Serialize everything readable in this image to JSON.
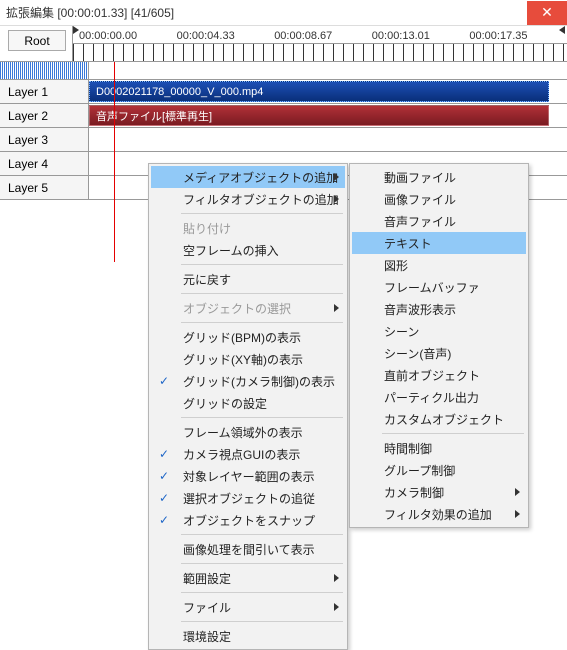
{
  "window": {
    "title": "拡張編集 [00:00:01.33] [41/605]"
  },
  "toolbar": {
    "root_label": "Root"
  },
  "ruler": {
    "labels": [
      "00:00:00.00",
      "00:00:04.33",
      "00:00:08.67",
      "00:00:13.01",
      "00:00:17.35"
    ]
  },
  "layers": [
    {
      "label": "Layer 1",
      "clip": "D0002021178_00000_V_000.mp4",
      "clip_type": "video"
    },
    {
      "label": "Layer 2",
      "clip": "音声ファイル[標準再生]",
      "clip_type": "audio"
    },
    {
      "label": "Layer 3"
    },
    {
      "label": "Layer 4"
    },
    {
      "label": "Layer 5"
    }
  ],
  "context_menu": [
    {
      "label": "メディアオブジェクトの追加",
      "submenu": true,
      "highlight": true
    },
    {
      "label": "フィルタオブジェクトの追加",
      "submenu": true
    },
    {
      "sep": true
    },
    {
      "label": "貼り付け",
      "disabled": true
    },
    {
      "label": "空フレームの挿入"
    },
    {
      "sep": true
    },
    {
      "label": "元に戻す"
    },
    {
      "sep": true
    },
    {
      "label": "オブジェクトの選択",
      "submenu": true,
      "disabled": true
    },
    {
      "sep": true
    },
    {
      "label": "グリッド(BPM)の表示"
    },
    {
      "label": "グリッド(XY軸)の表示"
    },
    {
      "label": "グリッド(カメラ制御)の表示",
      "checked": true
    },
    {
      "label": "グリッドの設定"
    },
    {
      "sep": true
    },
    {
      "label": "フレーム領域外の表示"
    },
    {
      "label": "カメラ視点GUIの表示",
      "checked": true
    },
    {
      "label": "対象レイヤー範囲の表示",
      "checked": true
    },
    {
      "label": "選択オブジェクトの追従",
      "checked": true
    },
    {
      "label": "オブジェクトをスナップ",
      "checked": true
    },
    {
      "sep": true
    },
    {
      "label": "画像処理を間引いて表示"
    },
    {
      "sep": true
    },
    {
      "label": "範囲設定",
      "submenu": true
    },
    {
      "sep": true
    },
    {
      "label": "ファイル",
      "submenu": true
    },
    {
      "sep": true
    },
    {
      "label": "環境設定"
    }
  ],
  "sub_menu": [
    {
      "label": "動画ファイル"
    },
    {
      "label": "画像ファイル"
    },
    {
      "label": "音声ファイル"
    },
    {
      "label": "テキスト",
      "highlight": true
    },
    {
      "label": "図形"
    },
    {
      "label": "フレームバッファ"
    },
    {
      "label": "音声波形表示"
    },
    {
      "label": "シーン"
    },
    {
      "label": "シーン(音声)"
    },
    {
      "label": "直前オブジェクト"
    },
    {
      "label": "パーティクル出力"
    },
    {
      "label": "カスタムオブジェクト"
    },
    {
      "sep": true
    },
    {
      "label": "時間制御"
    },
    {
      "label": "グループ制御"
    },
    {
      "label": "カメラ制御",
      "submenu": true
    },
    {
      "label": "フィルタ効果の追加",
      "submenu": true
    }
  ]
}
